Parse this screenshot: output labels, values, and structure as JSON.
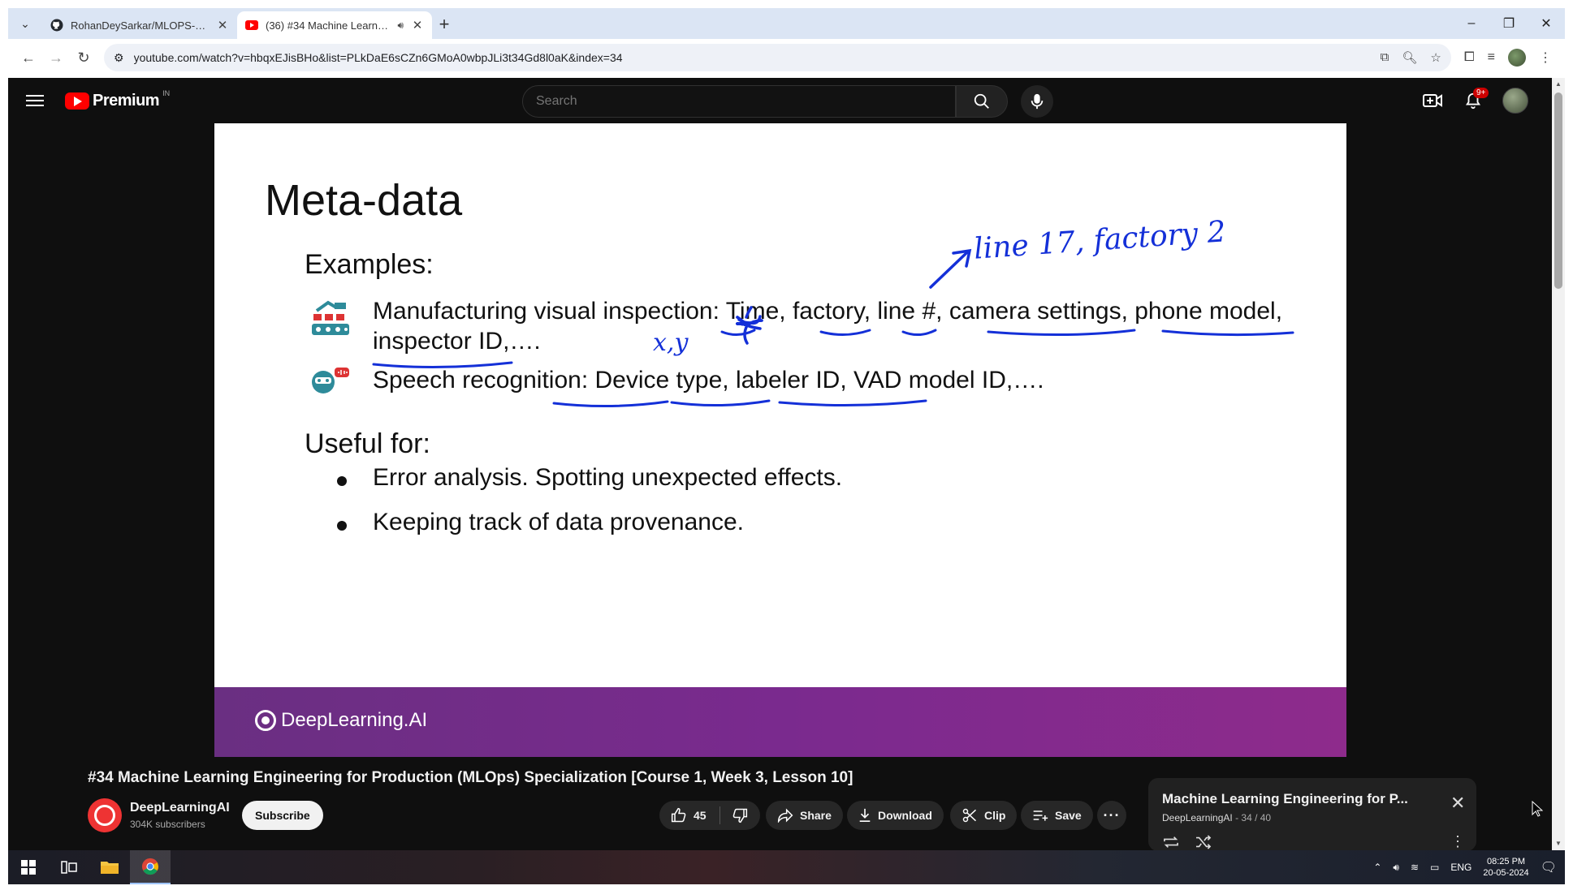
{
  "browser": {
    "tabs": [
      {
        "title": "RohanDeySarkar/MLOPS-Notes",
        "favicon": "github-icon",
        "active": false
      },
      {
        "title": "(36) #34 Machine Learning",
        "favicon": "youtube-icon",
        "active": true,
        "audio": true
      }
    ],
    "url": "youtube.com/watch?v=hbqxEJisBHo&list=PLkDaE6sCZn6GMoA0wbpJLi3t34Gd8l0aK&index=34"
  },
  "youtube": {
    "brand": "Premium",
    "country_code": "IN",
    "search_placeholder": "Search",
    "notification_count": "9+"
  },
  "slide": {
    "title": "Meta-data",
    "examples_heading": "Examples:",
    "manufacturing_line1_prefix": "Manufacturing visual inspection: ",
    "manufacturing_items": [
      "Time",
      "factory",
      "line #",
      "camera settings",
      "phone model"
    ],
    "manufacturing_line2": "inspector ID,….",
    "speech_prefix": "Speech recognition: ",
    "speech_items": [
      "Device type",
      "labeler ID",
      "VAD model ID,…."
    ],
    "useful_heading": "Useful for:",
    "bullets": [
      "Error analysis. Spotting unexpected effects.",
      "Keeping track of data provenance."
    ],
    "handwritten_note": "line 17, factory 2",
    "handwritten_xy": "x,y",
    "footer_brand": "DeepLearning.AI"
  },
  "video": {
    "title": "#34 Machine Learning Engineering for Production (MLOps) Specialization [Course 1, Week 3, Lesson 10]",
    "channel": "DeepLearningAI",
    "subscribers": "304K subscribers",
    "subscribe_label": "Subscribe",
    "likes": "45",
    "share_label": "Share",
    "download_label": "Download",
    "clip_label": "Clip",
    "save_label": "Save"
  },
  "playlist": {
    "title": "Machine Learning Engineering for P...",
    "channel": "DeepLearningAI",
    "position": "34 / 40"
  },
  "taskbar": {
    "language": "ENG",
    "time": "08:25 PM",
    "date": "20-05-2024"
  }
}
